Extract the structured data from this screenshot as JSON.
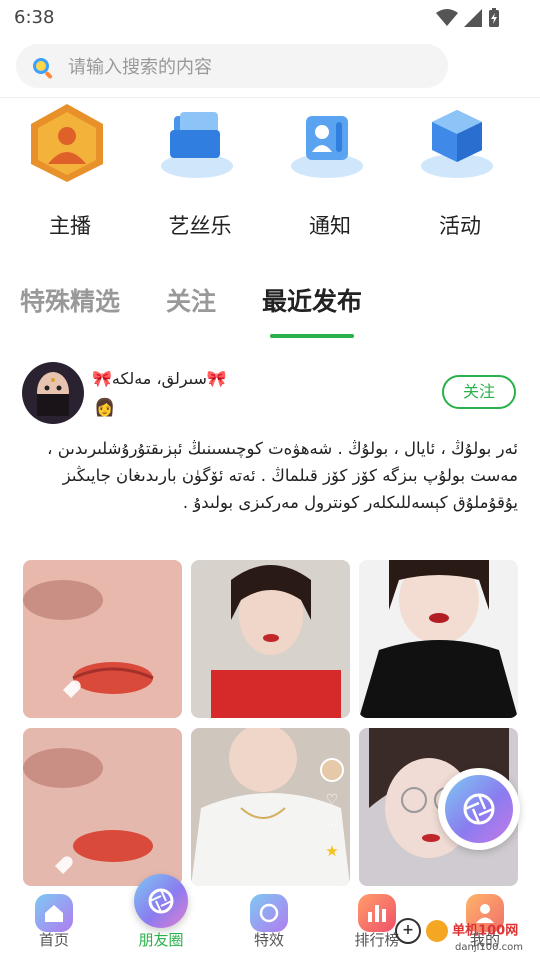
{
  "status": {
    "time": "6:38"
  },
  "search": {
    "placeholder": "请输入搜索的内容"
  },
  "categories": [
    {
      "label": "主播",
      "icon": "anchor-icon"
    },
    {
      "label": "艺丝乐",
      "icon": "folder-icon"
    },
    {
      "label": "通知",
      "icon": "notification-icon"
    },
    {
      "label": "活动",
      "icon": "cube-icon"
    }
  ],
  "tabs": [
    {
      "label": "特殊精选"
    },
    {
      "label": "关注"
    },
    {
      "label": "最近发布"
    }
  ],
  "post": {
    "username": "🎀سىرلق، مەلكە🎀",
    "gender_icon": "👩",
    "follow_label": "关注",
    "text": "ئەر بولۇڭ ، ئايال ، بولۇڭ . شەھۋەت كوچىسىنىڭ ئېزىقتۇرۇشلىرىدىن ، مەست بولۇپ بىزگە كۆز كۆز قىلماڭ . ئەتە ئۆگۈن بارىدىغان جايىڭىز يۇقۇملۇق كېسەللىكلەر كونترول مەركىزى بولىدۇ ."
  },
  "nav": [
    {
      "label": "首页",
      "color": "#8e7cf2"
    },
    {
      "label": "朋友圈",
      "color": "#8a7cf0"
    },
    {
      "label": "特效",
      "color": "#8e7cf2"
    },
    {
      "label": "排行榜",
      "color": "#f06a6a"
    },
    {
      "label": "我的",
      "color": "#f08a5d"
    }
  ],
  "watermark": {
    "title": "单机100网",
    "url": "danji100.com"
  },
  "colors": {
    "accent": "#2bb14a",
    "text": "#222222",
    "muted": "#999999"
  }
}
